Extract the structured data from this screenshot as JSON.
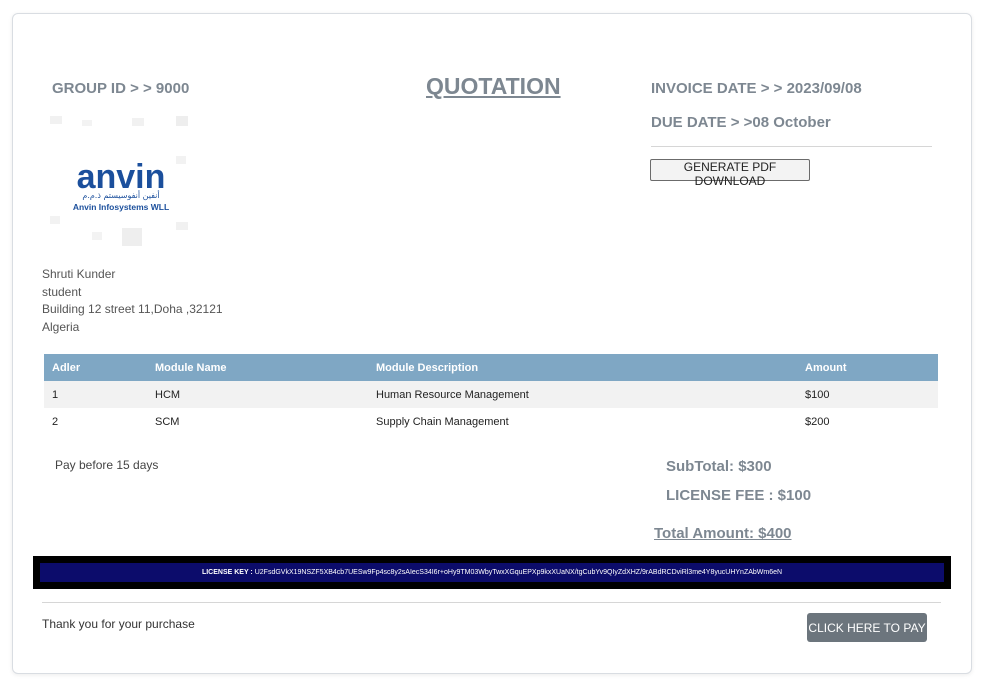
{
  "header": {
    "group_id": "GROUP ID > > 9000",
    "title": "QUOTATION",
    "invoice_date": "INVOICE DATE > > 2023/09/08",
    "due_date": "DUE DATE > >08 October",
    "pdf_button": "GENERATE PDF DOWNLOAD"
  },
  "logo": {
    "brand": "anvin",
    "arabic": "أنفين أنفوسيستم ذ.م.م",
    "company": "Anvin Infosystems WLL"
  },
  "customer": {
    "name": "Shruti Kunder",
    "role": "student",
    "address": "Building 12 street 11,Doha ,32121",
    "country": "Algeria"
  },
  "table": {
    "headers": [
      "Adler",
      "Module Name",
      "Module Description",
      "Amount"
    ],
    "rows": [
      [
        "1",
        "HCM",
        "Human Resource Management",
        "$100"
      ],
      [
        "2",
        "SCM",
        "Supply Chain Management",
        "$200"
      ]
    ]
  },
  "terms": "Pay before 15 days",
  "totals": {
    "subtotal": "SubTotal: $300",
    "license_fee": "LICENSE FEE : $100",
    "total": "Total Amount: $400"
  },
  "license": {
    "label": "LICENSE KEY :",
    "key": "U2FsdGVkX19NSZF5XB4cb7UESw9Fp4sc8y2sAIecS34I6r+oHy9TM03WbyTwxXGquEPXp9kxXUaNX/tgCubYv9QIyZdXHZ/9rABdRCDviRl3me4Y8yucUHYnZAbWm6eN"
  },
  "footer": {
    "thanks": "Thank you for your purchase",
    "pay_button": "CLICK HERE TO PAY"
  },
  "colors": {
    "accent": "#7fa7c4",
    "heading_gray": "#7d8791",
    "license_bg": "#0c0c6b",
    "logo_blue": "#1b4f9c"
  }
}
